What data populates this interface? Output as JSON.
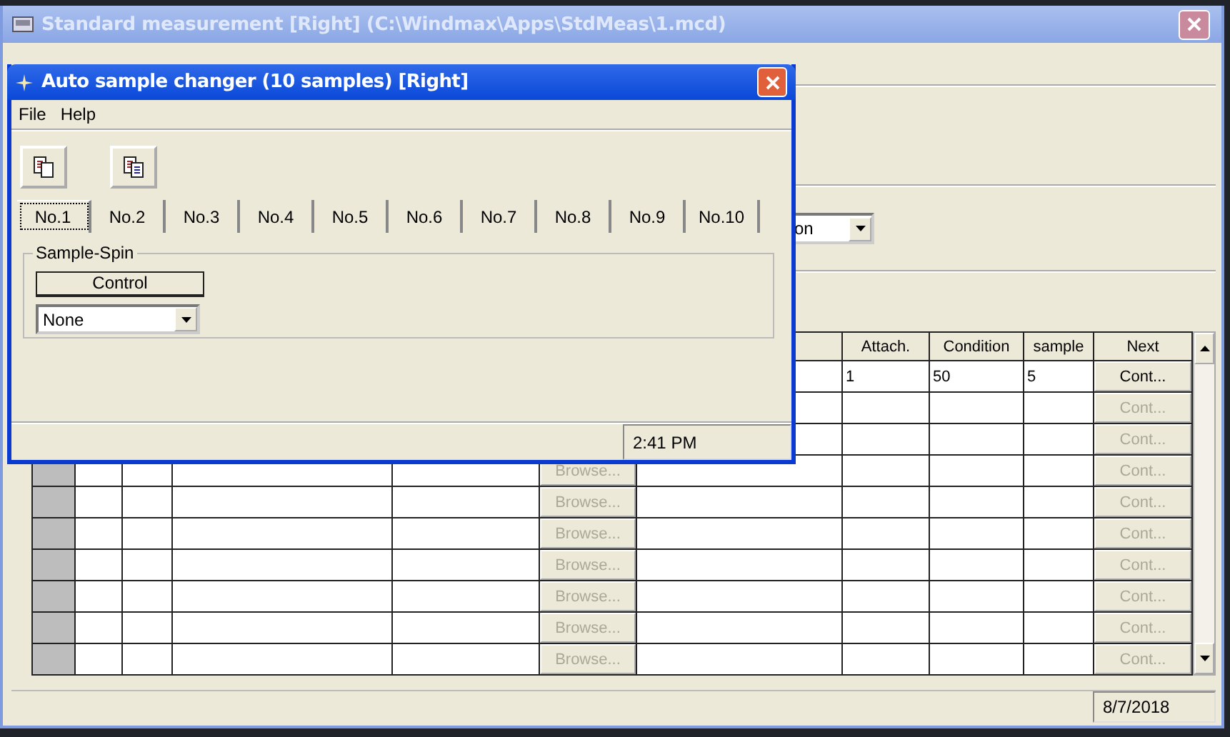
{
  "main_window": {
    "title": "Standard measurement [Right] (C:\\Windmax\\Apps\\StdMeas\\1.mcd)",
    "mode_dropdown": {
      "value": "on"
    },
    "table": {
      "columns": [
        "Attach.",
        "Condition",
        "sample",
        "Next"
      ],
      "rows": [
        {
          "attach": "1",
          "condition": "50",
          "sample": "5",
          "next": {
            "label": "Cont...",
            "disabled": false
          }
        },
        {
          "next": {
            "label": "Cont...",
            "disabled": true
          }
        },
        {
          "next": {
            "label": "Cont...",
            "disabled": true
          }
        },
        {
          "browse": {
            "label": "Browse...",
            "disabled": true
          },
          "next": {
            "label": "Cont...",
            "disabled": true
          }
        },
        {
          "browse": {
            "label": "Browse...",
            "disabled": true
          },
          "next": {
            "label": "Cont...",
            "disabled": true
          }
        },
        {
          "browse": {
            "label": "Browse...",
            "disabled": true
          },
          "next": {
            "label": "Cont...",
            "disabled": true
          }
        },
        {
          "browse": {
            "label": "Browse...",
            "disabled": true
          },
          "next": {
            "label": "Cont...",
            "disabled": true
          }
        },
        {
          "browse": {
            "label": "Browse...",
            "disabled": true
          },
          "next": {
            "label": "Cont...",
            "disabled": true
          }
        },
        {
          "browse": {
            "label": "Browse...",
            "disabled": true
          },
          "next": {
            "label": "Cont...",
            "disabled": true
          }
        },
        {
          "browse": {
            "label": "Browse...",
            "disabled": true
          },
          "next": {
            "label": "Cont...",
            "disabled": true
          }
        }
      ]
    },
    "status_bar": {
      "date": "8/7/2018"
    }
  },
  "dialog": {
    "title": "Auto sample changer (10 samples) [Right]",
    "menu": [
      "File",
      "Help"
    ],
    "tabs": [
      {
        "label": "No.1",
        "selected": true
      },
      {
        "label": "No.2",
        "selected": false
      },
      {
        "label": "No.3",
        "selected": false
      },
      {
        "label": "No.4",
        "selected": false
      },
      {
        "label": "No.5",
        "selected": false
      },
      {
        "label": "No.6",
        "selected": false
      },
      {
        "label": "No.7",
        "selected": false
      },
      {
        "label": "No.8",
        "selected": false
      },
      {
        "label": "No.9",
        "selected": false
      },
      {
        "label": "No.10",
        "selected": false
      }
    ],
    "group": {
      "title": "Sample-Spin",
      "header": "Control",
      "select": {
        "value": "None"
      }
    },
    "status_bar": {
      "time": "2:41 PM"
    }
  }
}
